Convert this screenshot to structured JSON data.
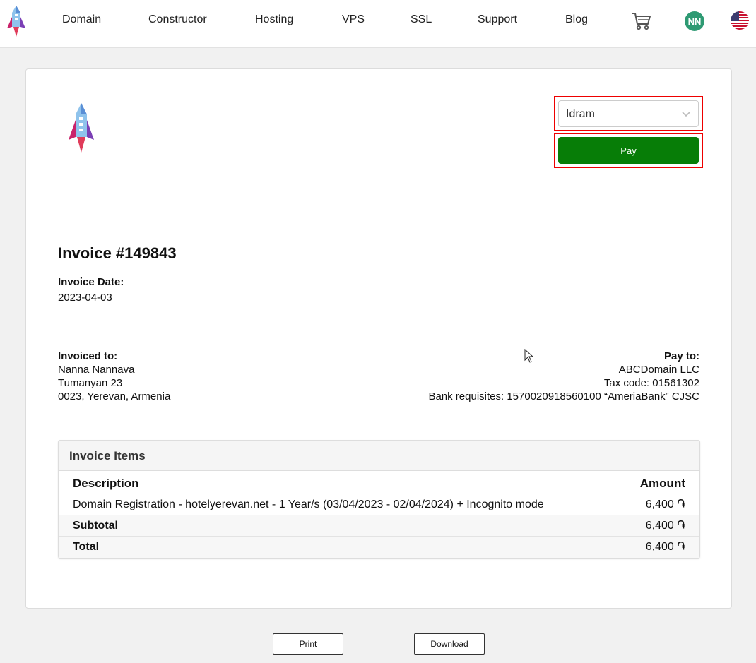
{
  "nav": {
    "items": [
      "Domain",
      "Constructor",
      "Hosting",
      "VPS",
      "SSL",
      "Support",
      "Blog"
    ],
    "avatar_initials": "NN",
    "icons": [
      "rocket-logo-icon",
      "cart-icon",
      "us-flag-icon"
    ]
  },
  "payment": {
    "method_selected": "Idram",
    "pay_label": "Pay"
  },
  "invoice": {
    "title": "Invoice #149843",
    "date_label": "Invoice Date:",
    "date": "2023-04-03",
    "invoiced_to": {
      "label": "Invoiced to:",
      "name": "Nanna Nannava",
      "street": "Tumanyan 23",
      "city": "0023, Yerevan, Armenia"
    },
    "pay_to": {
      "label": "Pay to:",
      "company": "ABCDomain LLC",
      "tax": "Tax code: 01561302",
      "bank": "Bank requisites: 1570020918560100 “AmeriaBank” CJSC"
    },
    "items": {
      "heading": "Invoice Items",
      "col_description": "Description",
      "col_amount": "Amount",
      "line_description": "Domain Registration - hotelyerevan.net - 1 Year/s (03/04/2023 - 02/04/2024) + Incognito mode",
      "line_amount": "6,400 ֏",
      "subtotal_label": "Subtotal",
      "subtotal": "6,400 ֏",
      "total_label": "Total",
      "total": "6,400 ֏"
    }
  },
  "actions": {
    "print_label": "Print",
    "download_label": "Download"
  },
  "colors": {
    "pay_green": "#077d07",
    "highlight_red": "#ee0000",
    "avatar_green": "#2e9a73"
  }
}
